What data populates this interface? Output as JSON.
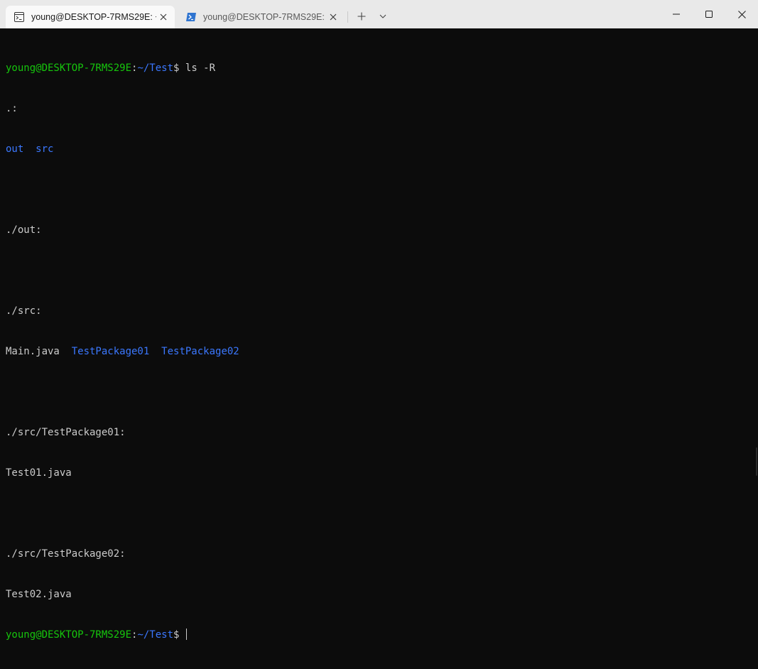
{
  "tabs": [
    {
      "title": "young@DESKTOP-7RMS29E: ~",
      "icon": "terminal-icon",
      "active": true
    },
    {
      "title": "young@DESKTOP-7RMS29E: ~",
      "icon": "powershell-icon",
      "active": false
    }
  ],
  "toolbar": {
    "new_tab": "+",
    "dropdown": "chevron-down-icon"
  },
  "window": {
    "minimize": "minimize-icon",
    "maximize": "maximize-icon",
    "close": "close-icon"
  },
  "prompt": {
    "user_host": "young@DESKTOP-7RMS29E",
    "sep": ":",
    "path": "~/Test",
    "dollar": "$"
  },
  "command": " ls -R",
  "output": {
    "root_header": ".:",
    "root_dirs": [
      "out",
      "src"
    ],
    "out_header": "./out:",
    "src_header": "./src:",
    "src_file": "Main.java",
    "src_dirs": [
      "TestPackage01",
      "TestPackage02"
    ],
    "pkg1_header": "./src/TestPackage01:",
    "pkg1_file": "Test01.java",
    "pkg2_header": "./src/TestPackage02:",
    "pkg2_file": "Test02.java"
  },
  "colors": {
    "prompt_user": "#16c60c",
    "prompt_path": "#3b78ff",
    "dir": "#3b78ff",
    "text": "#cccccc",
    "background": "#0c0c0c"
  }
}
